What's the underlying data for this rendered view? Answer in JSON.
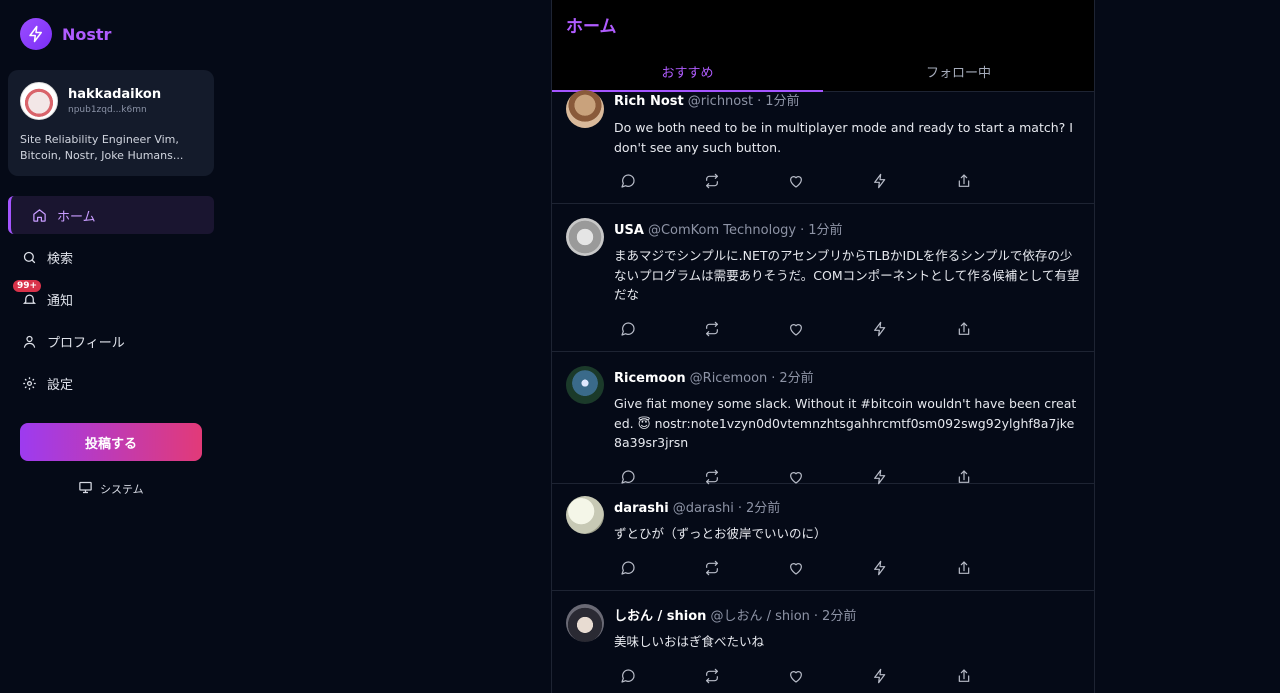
{
  "brand": {
    "name": "Nostr",
    "accent": "#b05cff"
  },
  "profile": {
    "name": "hakkadaikon",
    "npub": "npub1zqd...k6mn",
    "bio": "Site Reliability Engineer Vim, Bitcoin, Nostr, Joke Humans..."
  },
  "nav": {
    "items": [
      {
        "label": "ホーム",
        "icon": "home-icon",
        "active": true
      },
      {
        "label": "検索",
        "icon": "search-icon"
      },
      {
        "label": "通知",
        "icon": "bell-icon",
        "badge": "99+"
      },
      {
        "label": "プロフィール",
        "icon": "user-icon"
      },
      {
        "label": "設定",
        "icon": "gear-icon"
      }
    ]
  },
  "post_button": {
    "label": "投稿する"
  },
  "theme": {
    "label": "システム",
    "icon": "monitor-icon"
  },
  "header": {
    "title": "ホーム",
    "tabs": [
      {
        "label": "おすすめ",
        "active": true
      },
      {
        "label": "フォロー中",
        "active": false
      }
    ]
  },
  "feed": [
    {
      "author": "Rich Nost",
      "handle": "@richnost",
      "time": "1分前",
      "body": "Do we both need to be in multiplayer mode and ready to start a match? I don't see any such button."
    },
    {
      "author": "USA",
      "handle": "@ComKom Technology",
      "time": "1分前",
      "body": "まあマジでシンプルに.NETのアセンブリからTLBかIDLを作るシンプルで依存の少ないプログラムは需要ありそうだ。COMコンポーネントとして作る候補として有望だな"
    },
    {
      "author": "Ricemoon",
      "handle": "@Ricemoon",
      "time": "2分前",
      "body": "Give fiat money some slack. Without it #bitcoin wouldn't have been created. 😇 nostr:note1vzyn0d0vtemnzhtsgahhrcmtf0sm092swg92ylghf8a7jke8a39sr3jrsn"
    },
    {
      "author": "darashi",
      "handle": "@darashi",
      "time": "2分前",
      "body": "ずとひが（ずっとお彼岸でいいのに）"
    },
    {
      "author": "しおん / shion",
      "handle": "@しおん / shion",
      "time": "2分前",
      "body": "美味しいおはぎ食べたいね"
    }
  ],
  "actions": [
    "reply-icon",
    "repost-icon",
    "like-icon",
    "zap-icon",
    "share-icon"
  ],
  "dot": "·"
}
